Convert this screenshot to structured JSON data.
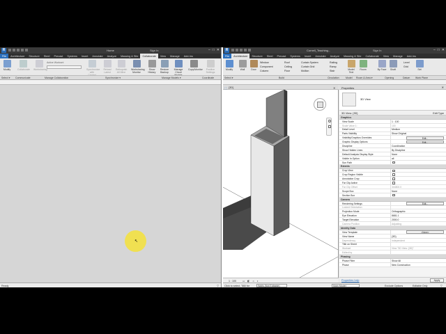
{
  "left_app": {
    "title": "Home",
    "signin": "Sign In",
    "tabs": [
      "File",
      "Architecture",
      "Structure",
      "Steel",
      "Precast",
      "Systems",
      "Insert",
      "Annotate",
      "Analyze",
      "Massing & Site",
      "Collaborate",
      "View",
      "Manage",
      "Add-Ins"
    ],
    "active_tab": "Collaborate",
    "ribbon": {
      "buttons": [
        "Modify",
        "Collaborate",
        "Worksharing",
        "Synchronize with Central",
        "Reload Latest",
        "Relinquish All Mine",
        "Worksharing Monitor",
        "Show History",
        "Restore Backup",
        "Manage Cloud Models",
        "Copy/Monitor",
        "Position Settings"
      ],
      "active_workset": "Active Workset:",
      "panels": [
        "Select ▾",
        "Communicate",
        "Manage Collaboration",
        "Synchronize ▾",
        "Manage Models ▾",
        "Coordinate"
      ]
    },
    "status": "Ready"
  },
  "right_app": {
    "title": "Cornell_Teaching...",
    "signin": "Sign In",
    "tabs": [
      "File",
      "Architecture",
      "Structure",
      "Steel",
      "Precast",
      "Systems",
      "Insert",
      "Annotate",
      "Analyze",
      "Massing & Site",
      "Collaborate",
      "View",
      "Manage",
      "Add-Ins"
    ],
    "active_tab": "Architecture",
    "ribbon": {
      "buttons": [
        "Modify",
        "Wall",
        "Door",
        "Window",
        "Component",
        "Column",
        "Roof",
        "Ceiling",
        "Floor",
        "Curtain System",
        "Curtain Grid",
        "Mullion",
        "Railing",
        "Ramp",
        "Stair",
        "Model Text",
        "Room",
        "By Face",
        "Shaft",
        "Level",
        "Grid",
        "Set"
      ],
      "panels": [
        "Select ▾",
        "Build",
        "Circulation",
        "Model",
        "Room & Area ▾",
        "Opening",
        "Datum",
        "Work Plane"
      ]
    },
    "view_tab": "{3D}",
    "view_scale": "1 : 100",
    "status": "Click to select, TAB for",
    "workset": "Walls (Not Editable)",
    "main_model": "Main Model",
    "exclude_options": "Exclude Options",
    "editable_only": "Editable Only"
  },
  "properties": {
    "header": "Properties",
    "type_name": "3D View",
    "selector": "3D View: {3D}",
    "edit_type": "Edit Type",
    "sections": [
      {
        "name": "Graphics",
        "rows": [
          {
            "k": "View Scale",
            "v": "1 : 100"
          },
          {
            "k": "Scale Value   1:",
            "v": "100",
            "dim": true
          },
          {
            "k": "Detail Level",
            "v": "Medium"
          },
          {
            "k": "Parts Visibility",
            "v": "Show Original"
          },
          {
            "k": "Visibility/Graphics Overrides",
            "v": "Edit...",
            "btn": true
          },
          {
            "k": "Graphic Display Options",
            "v": "Edit...",
            "btn": true
          },
          {
            "k": "Discipline",
            "v": "Coordination"
          },
          {
            "k": "Show Hidden Lines",
            "v": "By Discipline"
          },
          {
            "k": "Default Analysis Display Style",
            "v": "None"
          },
          {
            "k": "Visible In Option",
            "v": "all"
          },
          {
            "k": "Sun Path",
            "v": "",
            "cb": true
          }
        ]
      },
      {
        "name": "Extents",
        "rows": [
          {
            "k": "Crop View",
            "v": "",
            "cb": true
          },
          {
            "k": "Crop Region Visible",
            "v": "",
            "cb": true
          },
          {
            "k": "Annotation Crop",
            "v": "",
            "cb": true
          },
          {
            "k": "Far Clip Active",
            "v": "",
            "cb": true
          },
          {
            "k": "Far Clip Offset",
            "v": "304800.0",
            "dim": true
          },
          {
            "k": "Scope Box",
            "v": "None"
          },
          {
            "k": "Section Box",
            "v": "",
            "cb": true
          }
        ]
      },
      {
        "name": "Camera",
        "rows": [
          {
            "k": "Rendering Settings",
            "v": "Edit...",
            "btn": true
          },
          {
            "k": "Locked Orientation",
            "v": "",
            "dim": true
          },
          {
            "k": "Projection Mode",
            "v": "Orthographic"
          },
          {
            "k": "Eye Elevation",
            "v": "8681.1"
          },
          {
            "k": "Target Elevation",
            "v": "2000.0"
          },
          {
            "k": "Camera Position",
            "v": "Adjusting",
            "dim": true
          }
        ]
      },
      {
        "name": "Identity Data",
        "rows": [
          {
            "k": "View Template",
            "v": "<None>",
            "btn": true
          },
          {
            "k": "View Name",
            "v": "{3D}"
          },
          {
            "k": "Dependency",
            "v": "Independent",
            "dim": true
          },
          {
            "k": "Title on Sheet",
            "v": ""
          },
          {
            "k": "Workset",
            "v": "View \"3D View: {3D}\"",
            "dim": true
          },
          {
            "k": "Edited by",
            "v": "",
            "dim": true
          }
        ]
      },
      {
        "name": "Phasing",
        "rows": [
          {
            "k": "Phase Filter",
            "v": "Show All"
          },
          {
            "k": "Phase",
            "v": "New Construction"
          }
        ]
      }
    ],
    "help": "Properties help",
    "apply": "Apply"
  }
}
